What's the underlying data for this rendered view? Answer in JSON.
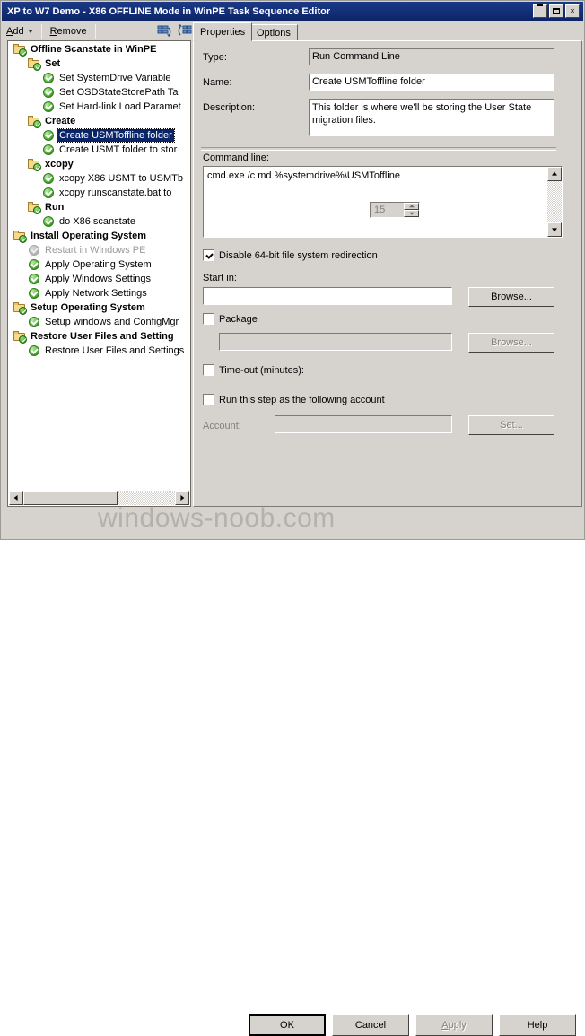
{
  "window": {
    "title": "XP to W7 Demo - X86 OFFLINE Mode in WinPE Task Sequence Editor",
    "controls": {
      "minimize": "minimize-icon",
      "maximize": "maximize-icon",
      "close": "×"
    }
  },
  "toolbar": {
    "add_label": "Add",
    "add_underline": "A",
    "remove_label": "Remove",
    "remove_underline": "R",
    "icons": [
      "move-up-icon",
      "move-down-icon"
    ]
  },
  "tabs": [
    {
      "label": "Properties",
      "active": true
    },
    {
      "label": "Options",
      "active": false
    }
  ],
  "tree": {
    "items": [
      {
        "label": "Offline Scanstate in WinPE",
        "indent": 0,
        "type": "folder",
        "selected": false,
        "disabled": false
      },
      {
        "label": "Set",
        "indent": 1,
        "type": "folder",
        "selected": false,
        "disabled": false
      },
      {
        "label": "Set SystemDrive Variable",
        "indent": 2,
        "type": "step",
        "selected": false,
        "disabled": false
      },
      {
        "label": "Set OSDStateStorePath Ta",
        "indent": 2,
        "type": "step",
        "selected": false,
        "disabled": false
      },
      {
        "label": "Set Hard-link Load Paramet",
        "indent": 2,
        "type": "step",
        "selected": false,
        "disabled": false
      },
      {
        "label": "Create",
        "indent": 1,
        "type": "folder",
        "selected": false,
        "disabled": false
      },
      {
        "label": "Create USMToffline folder",
        "indent": 2,
        "type": "step",
        "selected": true,
        "disabled": false
      },
      {
        "label": "Create USMT folder to stor",
        "indent": 2,
        "type": "step",
        "selected": false,
        "disabled": false
      },
      {
        "label": "xcopy",
        "indent": 1,
        "type": "folder",
        "selected": false,
        "disabled": false
      },
      {
        "label": "xcopy X86 USMT to USMTb",
        "indent": 2,
        "type": "step",
        "selected": false,
        "disabled": false
      },
      {
        "label": "xcopy runscanstate.bat to",
        "indent": 2,
        "type": "step",
        "selected": false,
        "disabled": false
      },
      {
        "label": "Run",
        "indent": 1,
        "type": "folder",
        "selected": false,
        "disabled": false
      },
      {
        "label": "do X86 scanstate",
        "indent": 2,
        "type": "step",
        "selected": false,
        "disabled": false
      },
      {
        "label": "Install Operating System",
        "indent": 0,
        "type": "folder",
        "selected": false,
        "disabled": false
      },
      {
        "label": "Restart in Windows PE",
        "indent": 1,
        "type": "step",
        "selected": false,
        "disabled": true
      },
      {
        "label": "Apply Operating System",
        "indent": 1,
        "type": "step",
        "selected": false,
        "disabled": false
      },
      {
        "label": "Apply Windows Settings",
        "indent": 1,
        "type": "step",
        "selected": false,
        "disabled": false
      },
      {
        "label": "Apply Network Settings",
        "indent": 1,
        "type": "step",
        "selected": false,
        "disabled": false
      },
      {
        "label": "Setup Operating System",
        "indent": 0,
        "type": "folder",
        "selected": false,
        "disabled": false
      },
      {
        "label": "Setup windows and ConfigMgr",
        "indent": 1,
        "type": "step",
        "selected": false,
        "disabled": false
      },
      {
        "label": "Restore User Files and Setting",
        "indent": 0,
        "type": "folder",
        "selected": false,
        "disabled": false
      },
      {
        "label": "Restore User Files and Settings",
        "indent": 1,
        "type": "step",
        "selected": false,
        "disabled": false
      }
    ]
  },
  "properties": {
    "type_label": "Type:",
    "type_value": "Run Command Line",
    "name_label": "Name:",
    "name_value": "Create USMToffline folder",
    "description_label": "Description:",
    "description_value": "This folder is where we'll be storing the User State migration files.",
    "commandline_label": "Command line:",
    "commandline_value": "cmd.exe /c md %systemdrive%\\USMToffline",
    "disable_redirection_label": "Disable 64-bit file system redirection",
    "disable_redirection_checked": true,
    "startin_label": "Start in:",
    "startin_value": "",
    "startin_browse_label": "Browse...",
    "package_label": "Package",
    "package_checked": false,
    "package_value": "",
    "package_browse_label": "Browse...",
    "timeout_label": "Time-out (minutes):",
    "timeout_checked": false,
    "timeout_value": "15",
    "runas_label": "Run this step as the following account",
    "runas_checked": false,
    "account_label": "Account:",
    "account_value": "",
    "account_set_label": "Set..."
  },
  "footer": {
    "ok_label": "OK",
    "cancel_label": "Cancel",
    "apply_label": "Apply",
    "apply_underline": "A",
    "help_label": "Help",
    "watermark": "windows-noob.com"
  },
  "colors": {
    "titlebar": "#14307a",
    "face": "#d6d3ce",
    "selection": "#0a246a",
    "watermark": "#b4b1ab"
  }
}
